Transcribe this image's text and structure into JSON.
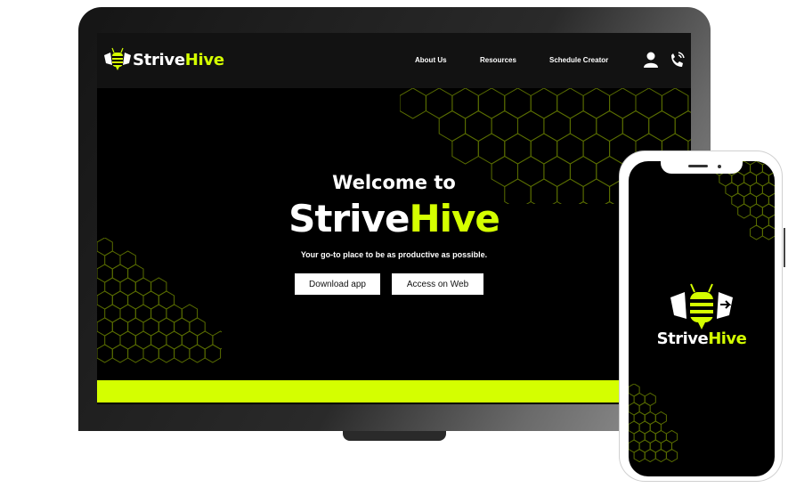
{
  "brand": {
    "strive": "Strive",
    "hive": "Hive"
  },
  "nav": {
    "links": [
      "About Us",
      "Resources",
      "Schedule Creator"
    ],
    "icons": [
      "user-icon",
      "phone-call-icon"
    ]
  },
  "hero": {
    "welcome": "Welcome to",
    "tagline": "Your go-to place to be as productive as possible.",
    "download_label": "Download app",
    "web_label": "Access on Web"
  },
  "colors": {
    "accent": "#d4ff00",
    "background": "#000000",
    "nav": "#121212"
  }
}
